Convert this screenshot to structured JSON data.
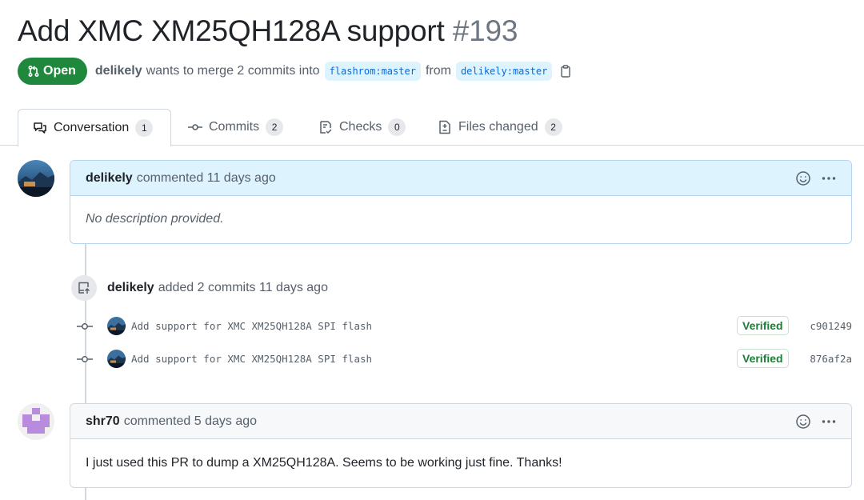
{
  "pr": {
    "title": "Add XMC XM25QH128A support",
    "number": "#193",
    "state": "Open",
    "author": "delikely",
    "merge_text": "wants to merge 2 commits into",
    "base_branch": "flashrom:master",
    "from_text": "from",
    "head_branch": "delikely:master"
  },
  "tabs": [
    {
      "label": "Conversation",
      "count": "1",
      "icon": "comment-discussion-icon"
    },
    {
      "label": "Commits",
      "count": "2",
      "icon": "git-commit-icon"
    },
    {
      "label": "Checks",
      "count": "0",
      "icon": "checklist-icon"
    },
    {
      "label": "Files changed",
      "count": "2",
      "icon": "file-diff-icon"
    }
  ],
  "comments": [
    {
      "author": "delikely",
      "action": "commented 11 days ago",
      "body": "No description provided."
    },
    {
      "author": "shr70",
      "action": "commented 5 days ago",
      "body": "I just used this PR to dump a XM25QH128A. Seems to be working just fine. Thanks!"
    }
  ],
  "push_event": {
    "author": "delikely",
    "text": "added 2 commits 11 days ago"
  },
  "commits": [
    {
      "message": "Add support for XMC XM25QH128A SPI flash",
      "badge": "Verified",
      "sha": "c901249"
    },
    {
      "message": "Add support for XMC XM25QH128A SPI flash",
      "badge": "Verified",
      "sha": "876af2a"
    }
  ],
  "colors": {
    "open_green": "#1f883d",
    "verified_green": "#1a7f37",
    "link_blue": "#0969da",
    "shr70_avatar_purple": "#b98bdc"
  }
}
